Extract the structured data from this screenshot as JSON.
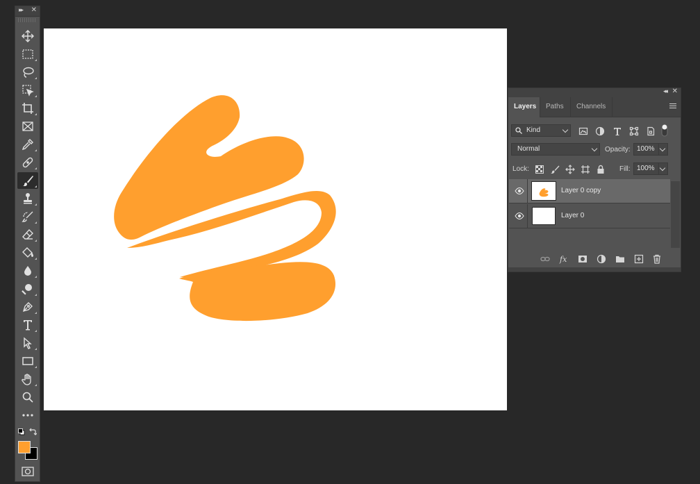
{
  "toolbar": {
    "tools": [
      {
        "name": "move-tool",
        "icon": "move-icon",
        "active": false
      },
      {
        "name": "marquee-tool",
        "icon": "rect-marquee-icon",
        "active": false
      },
      {
        "name": "lasso-tool",
        "icon": "lasso-icon",
        "active": false
      },
      {
        "name": "object-select-tool",
        "icon": "object-select-icon",
        "active": false
      },
      {
        "name": "crop-tool",
        "icon": "crop-icon",
        "active": false
      },
      {
        "name": "frame-tool",
        "icon": "frame-icon",
        "active": false
      },
      {
        "name": "eyedropper-tool",
        "icon": "eyedropper-icon",
        "active": false
      },
      {
        "name": "healing-brush-tool",
        "icon": "bandage-icon",
        "active": false
      },
      {
        "name": "brush-tool",
        "icon": "brush-icon",
        "active": true
      },
      {
        "name": "clone-stamp-tool",
        "icon": "stamp-icon",
        "active": false
      },
      {
        "name": "history-brush-tool",
        "icon": "history-brush-icon",
        "active": false
      },
      {
        "name": "eraser-tool",
        "icon": "eraser-icon",
        "active": false
      },
      {
        "name": "paint-bucket-tool",
        "icon": "bucket-icon",
        "active": false
      },
      {
        "name": "blur-tool",
        "icon": "drop-icon",
        "active": false
      },
      {
        "name": "dodge-tool",
        "icon": "dodge-icon",
        "active": false
      },
      {
        "name": "pen-tool",
        "icon": "pen-icon",
        "active": false
      },
      {
        "name": "type-tool",
        "icon": "type-icon",
        "active": false
      },
      {
        "name": "path-select-tool",
        "icon": "arrow-icon",
        "active": false
      },
      {
        "name": "rectangle-tool",
        "icon": "rectangle-icon",
        "active": false
      },
      {
        "name": "hand-tool",
        "icon": "hand-icon",
        "active": false
      },
      {
        "name": "zoom-tool",
        "icon": "zoom-icon",
        "active": false
      },
      {
        "name": "edit-toolbar",
        "icon": "more-icon",
        "active": false
      }
    ],
    "foreground_color": "#ff9f2e",
    "background_color": "#000000"
  },
  "canvas": {
    "background": "#ffffff",
    "stroke_color": "#ff9f2e"
  },
  "layers_panel": {
    "tabs": [
      {
        "label": "Layers",
        "active": true
      },
      {
        "label": "Paths",
        "active": false
      },
      {
        "label": "Channels",
        "active": false
      }
    ],
    "filter": {
      "label": "Kind"
    },
    "blend_mode": "Normal",
    "opacity_label": "Opacity:",
    "opacity_value": "100%",
    "lock_label": "Lock:",
    "fill_label": "Fill:",
    "fill_value": "100%",
    "layers": [
      {
        "name": "Layer 0 copy",
        "visible": true,
        "selected": true
      },
      {
        "name": "Layer 0",
        "visible": true,
        "selected": false
      }
    ]
  }
}
